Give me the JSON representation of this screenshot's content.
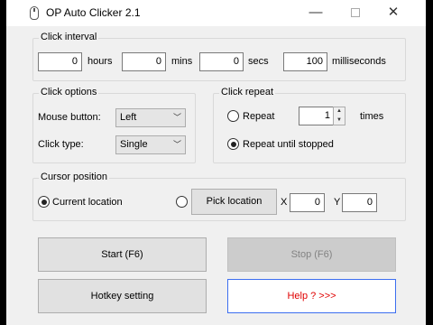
{
  "window": {
    "title": "OP Auto Clicker 2.1",
    "min": "—",
    "max": "",
    "close": "✕"
  },
  "click_interval": {
    "label": "Click interval",
    "hours": {
      "value": "0",
      "unit": "hours"
    },
    "mins": {
      "value": "0",
      "unit": "mins"
    },
    "secs": {
      "value": "0",
      "unit": "secs"
    },
    "ms": {
      "value": "100",
      "unit": "milliseconds"
    }
  },
  "click_options": {
    "label": "Click options",
    "mouse_button": {
      "label": "Mouse button:",
      "value": "Left"
    },
    "click_type": {
      "label": "Click type:",
      "value": "Single"
    }
  },
  "click_repeat": {
    "label": "Click repeat",
    "repeat": {
      "label": "Repeat",
      "value": "1",
      "unit": "times",
      "selected": false
    },
    "repeat_until_stopped": {
      "label": "Repeat until stopped",
      "selected": true
    }
  },
  "cursor_position": {
    "label": "Cursor position",
    "current_location": {
      "label": "Current location",
      "selected": true
    },
    "pick_location": {
      "label": "Pick location",
      "selected": false
    },
    "x": {
      "label": "X",
      "value": "0"
    },
    "y": {
      "label": "Y",
      "value": "0"
    }
  },
  "buttons": {
    "start": "Start (F6)",
    "stop": "Stop (F6)",
    "hotkey": "Hotkey setting",
    "help": "Help ? >>>"
  }
}
